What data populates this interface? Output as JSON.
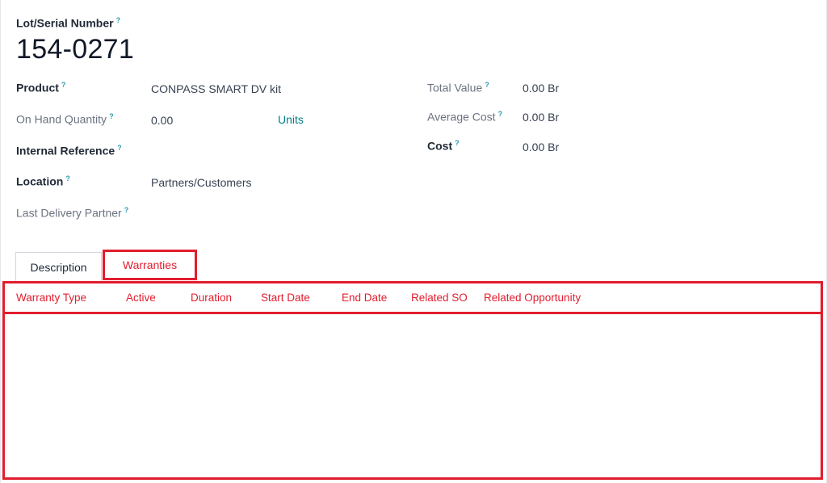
{
  "record": {
    "lot_label": "Lot/Serial Number",
    "serial": "154-0271"
  },
  "fields_left": {
    "product": {
      "label": "Product",
      "value": "CONPASS SMART DV kit"
    },
    "on_hand": {
      "label": "On Hand Quantity",
      "value": "0.00",
      "unit": "Units"
    },
    "internal_ref": {
      "label": "Internal Reference",
      "value": ""
    },
    "location": {
      "label": "Location",
      "value": "Partners/Customers"
    },
    "last_delivery": {
      "label": "Last Delivery Partner",
      "value": ""
    }
  },
  "fields_right": {
    "total_value": {
      "label": "Total Value",
      "value": "0.00 Br"
    },
    "average_cost": {
      "label": "Average Cost",
      "value": "0.00 Br"
    },
    "cost": {
      "label": "Cost",
      "value": "0.00 Br"
    }
  },
  "help_glyph": "?",
  "tabs": [
    {
      "label": "Description"
    },
    {
      "label": "Warranties"
    }
  ],
  "warranty_table": {
    "columns": [
      "Warranty Type",
      "Active",
      "Duration",
      "Start Date",
      "End Date",
      "Related SO",
      "Related Opportunity"
    ],
    "rows": []
  },
  "colors": {
    "highlight": "#e11d2e",
    "link": "#017e84",
    "help": "#2b9ab0"
  }
}
